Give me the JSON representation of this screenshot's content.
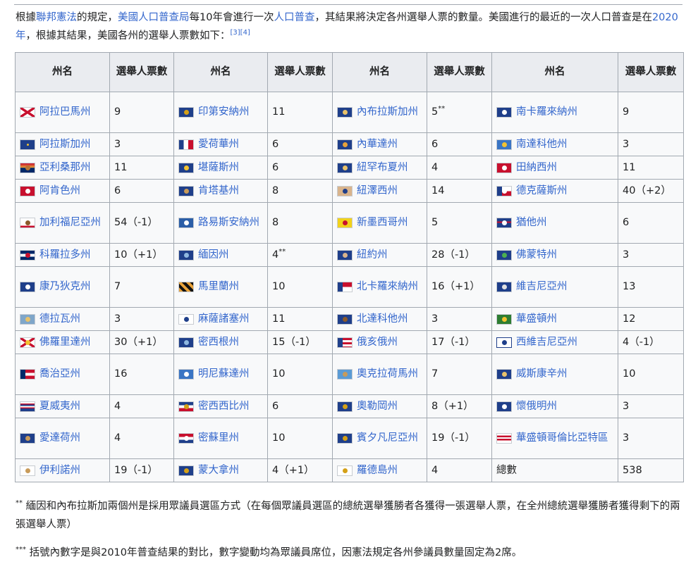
{
  "intro": {
    "p1": "根據",
    "link1": "聯邦憲法",
    "p2": "的規定，",
    "link2": "美國人口普查局",
    "p3": "每10年會進行一次",
    "link3": "人口普查",
    "p4": "，其結果將決定各州選舉人票的數量。美國進行的最近的一次人口普查是在",
    "link4": "2020年",
    "p5": "，根據其結果，美國各州的選舉人票數如下：",
    "refs": "[3][4]"
  },
  "table": {
    "header": {
      "state": "州名",
      "votes": "選舉人票數"
    },
    "rows": [
      [
        {
          "name": "阿拉巴馬州",
          "votes": "9",
          "flag": "al",
          "link": true
        },
        {
          "name": "印第安納州",
          "votes": "11",
          "flag": "in",
          "link": true
        },
        {
          "name": "內布拉斯加州",
          "votes": "5",
          "sup": "**",
          "flag": "ne",
          "link": true
        },
        {
          "name": "南卡羅來納州",
          "votes": "9",
          "flag": "sc",
          "link": true
        }
      ],
      [
        {
          "name": "阿拉斯加州",
          "votes": "3",
          "flag": "ak",
          "link": true
        },
        {
          "name": "愛荷華州",
          "votes": "6",
          "flag": "ia",
          "link": true
        },
        {
          "name": "內華達州",
          "votes": "6",
          "flag": "nv",
          "link": true
        },
        {
          "name": "南達科他州",
          "votes": "3",
          "flag": "sd",
          "link": true
        }
      ],
      [
        {
          "name": "亞利桑那州",
          "votes": "11",
          "flag": "az",
          "link": true
        },
        {
          "name": "堪薩斯州",
          "votes": "6",
          "flag": "ks",
          "link": true
        },
        {
          "name": "紐罕布夏州",
          "votes": "4",
          "flag": "nh",
          "link": true
        },
        {
          "name": "田納西州",
          "votes": "11",
          "flag": "tn",
          "link": true
        }
      ],
      [
        {
          "name": "阿肯色州",
          "votes": "6",
          "flag": "ar",
          "link": true
        },
        {
          "name": "肯塔基州",
          "votes": "8",
          "flag": "ky",
          "link": true
        },
        {
          "name": "紐澤西州",
          "votes": "14",
          "flag": "nj",
          "link": true
        },
        {
          "name": "德克薩斯州",
          "votes": "40（+2）",
          "flag": "tx",
          "link": true
        }
      ],
      [
        {
          "name": "加利福尼亞州",
          "votes": "54（-1）",
          "flag": "ca",
          "link": true
        },
        {
          "name": "路易斯安納州",
          "votes": "8",
          "flag": "la",
          "link": true
        },
        {
          "name": "新墨西哥州",
          "votes": "5",
          "flag": "nm",
          "link": true
        },
        {
          "name": "猶他州",
          "votes": "6",
          "flag": "ut",
          "link": true
        }
      ],
      [
        {
          "name": "科羅拉多州",
          "votes": "10（+1）",
          "flag": "co",
          "link": true
        },
        {
          "name": "緬因州",
          "votes": "4",
          "sup": "**",
          "flag": "me",
          "link": true
        },
        {
          "name": "紐約州",
          "votes": "28（-1）",
          "flag": "ny",
          "link": true
        },
        {
          "name": "佛蒙特州",
          "votes": "3",
          "flag": "vt",
          "link": true
        }
      ],
      [
        {
          "name": "康乃狄克州",
          "votes": "7",
          "flag": "ct",
          "link": true
        },
        {
          "name": "馬里蘭州",
          "votes": "10",
          "flag": "md",
          "link": true
        },
        {
          "name": "北卡羅來納州",
          "votes": "16（+1）",
          "flag": "nc",
          "link": true
        },
        {
          "name": "維吉尼亞州",
          "votes": "13",
          "flag": "va",
          "link": true
        }
      ],
      [
        {
          "name": "德拉瓦州",
          "votes": "3",
          "flag": "de",
          "link": true
        },
        {
          "name": "麻薩諸塞州",
          "votes": "11",
          "flag": "ma",
          "link": true
        },
        {
          "name": "北達科他州",
          "votes": "3",
          "flag": "nd",
          "link": true
        },
        {
          "name": "華盛頓州",
          "votes": "12",
          "flag": "wa",
          "link": true
        }
      ],
      [
        {
          "name": "佛羅里達州",
          "votes": "30（+1）",
          "flag": "fl",
          "link": true
        },
        {
          "name": "密西根州",
          "votes": "15（-1）",
          "flag": "mi",
          "link": true
        },
        {
          "name": "俄亥俄州",
          "votes": "17（-1）",
          "flag": "oh",
          "link": true
        },
        {
          "name": "西維吉尼亞州",
          "votes": "4（-1）",
          "flag": "wv",
          "link": true
        }
      ],
      [
        {
          "name": "喬治亞州",
          "votes": "16",
          "flag": "ga",
          "link": true
        },
        {
          "name": "明尼蘇達州",
          "votes": "10",
          "flag": "mn",
          "link": true
        },
        {
          "name": "奧克拉荷馬州",
          "votes": "7",
          "flag": "ok",
          "link": true
        },
        {
          "name": "威斯康辛州",
          "votes": "10",
          "flag": "wi",
          "link": true
        }
      ],
      [
        {
          "name": "夏威夷州",
          "votes": "4",
          "flag": "hi",
          "link": true
        },
        {
          "name": "密西西比州",
          "votes": "6",
          "flag": "ms",
          "link": true
        },
        {
          "name": "奧勒岡州",
          "votes": "8（+1）",
          "flag": "or",
          "link": true
        },
        {
          "name": "懷俄明州",
          "votes": "3",
          "flag": "wy",
          "link": true
        }
      ],
      [
        {
          "name": "愛達荷州",
          "votes": "4",
          "flag": "id",
          "link": true
        },
        {
          "name": "密蘇里州",
          "votes": "10",
          "flag": "mo",
          "link": true
        },
        {
          "name": "賓夕凡尼亞州",
          "votes": "19（-1）",
          "flag": "pa",
          "link": true
        },
        {
          "name": "華盛頓哥倫比亞特區",
          "votes": "3",
          "flag": "dc",
          "link": true
        }
      ],
      [
        {
          "name": "伊利諾州",
          "votes": "19（-1）",
          "flag": "il",
          "link": true
        },
        {
          "name": "蒙大拿州",
          "votes": "4（+1）",
          "flag": "mt",
          "link": true
        },
        {
          "name": "羅德島州",
          "votes": "4",
          "flag": "ri",
          "link": true
        },
        {
          "name": "總數",
          "votes": "538",
          "flag": "",
          "link": false
        }
      ]
    ]
  },
  "notes": {
    "note1_mark": "**",
    "note1_text": "緬因和內布拉斯加兩個州是採用眾議員選區方式（在每個眾議員選區的總統選舉獲勝者各獲得一張選舉人票，在全州總統選舉獲勝者獲得剩下的兩張選舉人票）",
    "note2_mark": "***",
    "note2_text": "括號內數字是與2010年普查結果的對比，數字變動均為眾議員席位，因憲法規定各州參議員數量固定為2席。"
  },
  "colors": {
    "link": "#3366cc",
    "header_bg": "#eaecf0",
    "cell_bg": "#f8f9fa",
    "border": "#a2a9b1",
    "text": "#202122"
  }
}
